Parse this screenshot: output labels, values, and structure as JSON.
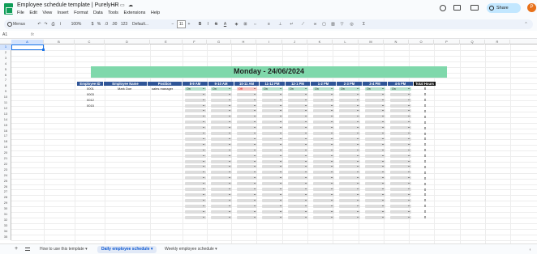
{
  "app": {
    "doc_title": "Employee schedule template | PurelyHR",
    "icon_name": "sheets-logo-icon"
  },
  "menu": [
    "File",
    "Edit",
    "View",
    "Insert",
    "Format",
    "Data",
    "Tools",
    "Extensions",
    "Help"
  ],
  "top_right": {
    "share_label": "Share",
    "avatar_letter": "P"
  },
  "toolbar": {
    "search_label": "Menus",
    "zoom": "100%",
    "font": "Default...",
    "font_size": "11",
    "currency": "$",
    "percent": "%",
    "dec_dec": ".0",
    "inc_dec": ".00",
    "num_format": "123",
    "minus": "−",
    "plus": "+"
  },
  "formula_bar": {
    "name_box": "A1",
    "fx": "fx"
  },
  "columns": [
    "A",
    "B",
    "C",
    "D",
    "E",
    "F",
    "G",
    "H",
    "I",
    "J",
    "K",
    "L",
    "M",
    "N",
    "O",
    "P",
    "Q",
    "R"
  ],
  "rows": [
    "1",
    "2",
    "3",
    "4",
    "5",
    "6",
    "7",
    "8",
    "9",
    "10",
    "11",
    "12",
    "13",
    "14",
    "15",
    "16",
    "17",
    "18",
    "19",
    "20",
    "21",
    "22",
    "23",
    "24",
    "25",
    "26",
    "27",
    "28",
    "29",
    "30",
    "31",
    "32",
    "33",
    "34",
    "35"
  ],
  "schedule": {
    "title": "Monday - 24/06/2024",
    "headers": [
      "Employee ID",
      "Employee Name",
      "Position",
      "8-9 AM",
      "9-10 AM",
      "10-11 AM",
      "11-12 PM",
      "12-1 PM",
      "1-2 PM",
      "2-3 PM",
      "3-4 PM",
      "4-5 PM",
      "Total Hours"
    ],
    "employee_ids": [
      "0001",
      "0003",
      "0012",
      "0015"
    ],
    "employee_name": "Mark Doe",
    "position": "sales manager",
    "first_row_status": [
      "On",
      "On",
      "Off",
      "On",
      "On",
      "On",
      "On",
      "On",
      "On"
    ],
    "totals": [
      "8",
      "0",
      "0",
      "0",
      "0",
      "0",
      "0",
      "0",
      "0",
      "0",
      "0",
      "0",
      "0",
      "0",
      "0",
      "0",
      "0",
      "0",
      "0",
      "0",
      "0",
      "0",
      "0",
      "0"
    ]
  },
  "sheets": [
    "How to use this template",
    "Daily employee schedule",
    "Weekly employee schedule"
  ],
  "active_sheet_index": 1,
  "colors": {
    "header_blue": "#2f5597",
    "title_green": "#7fd8ab",
    "on_green": "#b7e1cd",
    "off_red": "#f4c7c3",
    "accent": "#1a73e8"
  }
}
